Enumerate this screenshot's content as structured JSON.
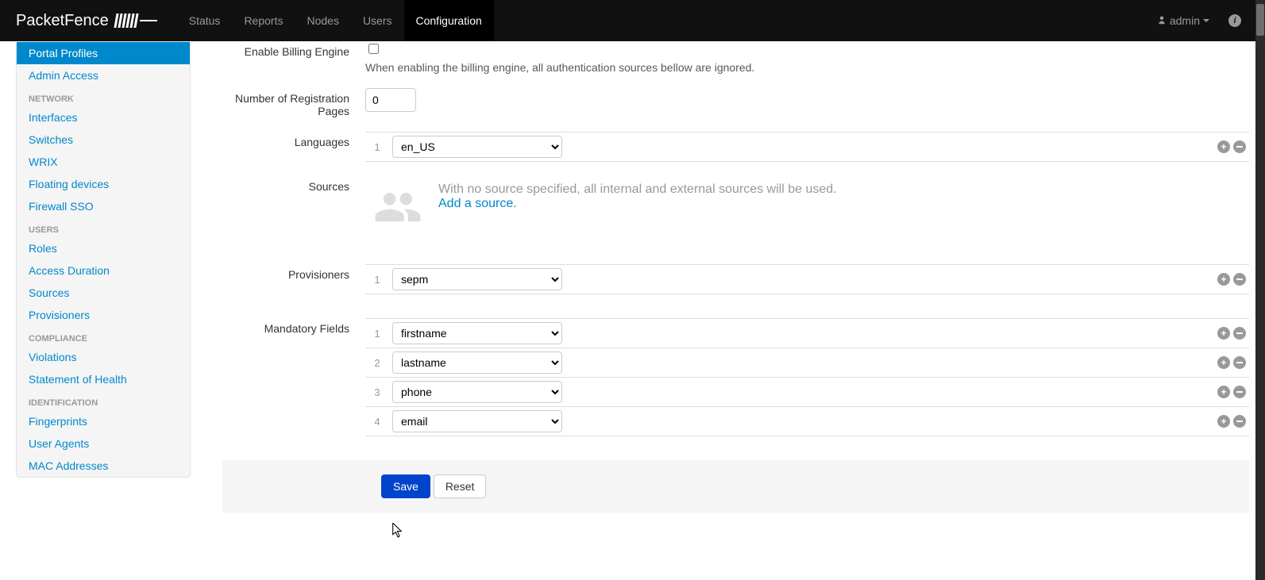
{
  "brand": "PacketFence",
  "nav": {
    "items": [
      "Status",
      "Reports",
      "Nodes",
      "Users",
      "Configuration"
    ],
    "active": "Configuration"
  },
  "user_menu": {
    "label": "admin"
  },
  "sidebar": {
    "top": [
      {
        "label": "Portal Profiles",
        "active": true
      },
      {
        "label": "Admin Access"
      }
    ],
    "groups": [
      {
        "header": "Network",
        "items": [
          "Interfaces",
          "Switches",
          "WRIX",
          "Floating devices",
          "Firewall SSO"
        ]
      },
      {
        "header": "Users",
        "items": [
          "Roles",
          "Access Duration",
          "Sources",
          "Provisioners"
        ]
      },
      {
        "header": "Compliance",
        "items": [
          "Violations",
          "Statement of Health"
        ]
      },
      {
        "header": "Identification",
        "items": [
          "Fingerprints",
          "User Agents",
          "MAC Addresses"
        ]
      }
    ]
  },
  "form": {
    "billing": {
      "label": "Enable Billing Engine",
      "checked": false,
      "help": "When enabling the billing engine, all authentication sources bellow are ignored."
    },
    "reg_pages": {
      "label": "Number of Registration Pages",
      "value": "0"
    },
    "languages": {
      "label": "Languages",
      "rows": [
        {
          "idx": "1",
          "value": "en_US"
        }
      ]
    },
    "sources": {
      "label": "Sources",
      "empty_text": "With no source specified, all internal and external sources will be used.",
      "add_link": "Add a source."
    },
    "provisioners": {
      "label": "Provisioners",
      "rows": [
        {
          "idx": "1",
          "value": "sepm"
        }
      ]
    },
    "mandatory": {
      "label": "Mandatory Fields",
      "rows": [
        {
          "idx": "1",
          "value": "firstname"
        },
        {
          "idx": "2",
          "value": "lastname"
        },
        {
          "idx": "3",
          "value": "phone"
        },
        {
          "idx": "4",
          "value": "email"
        }
      ]
    },
    "actions": {
      "save": "Save",
      "reset": "Reset"
    }
  }
}
